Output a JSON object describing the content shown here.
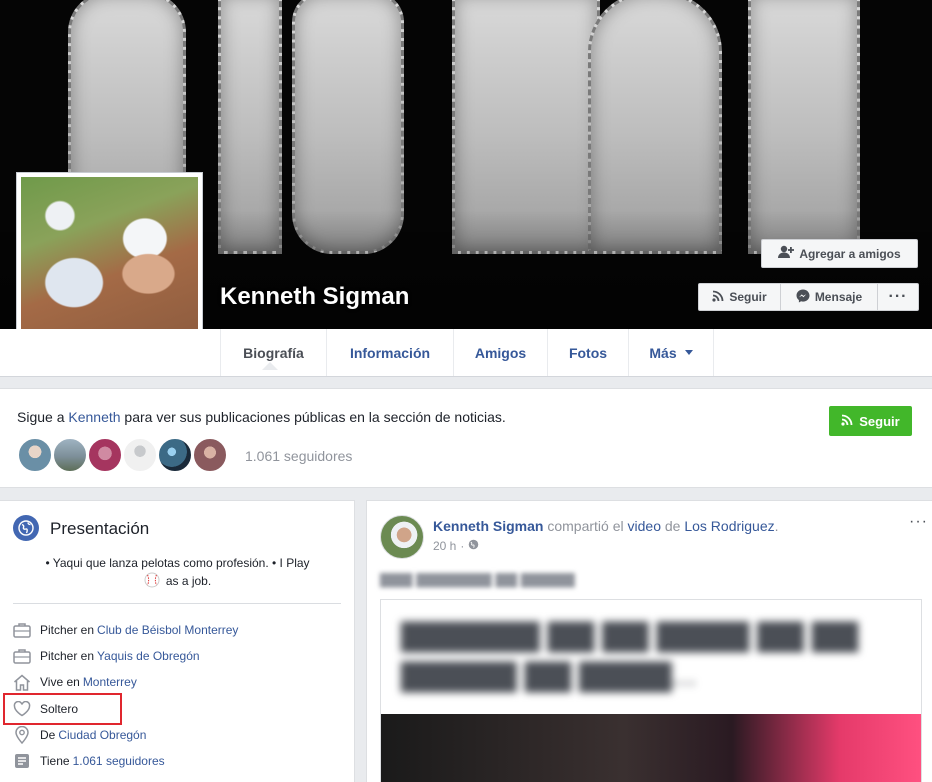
{
  "cover": {
    "text": "SIGMAN"
  },
  "profile": {
    "name": "Kenneth Sigman"
  },
  "actions": {
    "add_friend": "Agregar a amigos",
    "follow": "Seguir",
    "message": "Mensaje",
    "more": "···"
  },
  "nav": {
    "tabs": [
      {
        "label": "Biografía"
      },
      {
        "label": "Información"
      },
      {
        "label": "Amigos"
      },
      {
        "label": "Fotos"
      },
      {
        "label": "Más"
      }
    ]
  },
  "follow_card": {
    "prefix": "Sigue a ",
    "name_link": "Kenneth",
    "suffix": " para ver sus publicaciones públicas en la sección de noticias.",
    "button": "Seguir",
    "followers": "1.061 seguidores",
    "avatar_colors": [
      "#6a8fa6",
      "#7d8f99",
      "#a5355f",
      "#f0f0f0",
      "#3c6a86",
      "#8a5a5e"
    ]
  },
  "intro": {
    "title": "Presentación",
    "bio_line1": "• Yaqui que lanza pelotas como profesión. • I Play",
    "bio_line2": "as a job.",
    "items": [
      {
        "icon": "briefcase-icon",
        "prefix": "Pitcher en ",
        "link": "Club de Béisbol Monterrey"
      },
      {
        "icon": "briefcase-icon",
        "prefix": "Pitcher en ",
        "link": "Yaquis de Obregón"
      },
      {
        "icon": "home-icon",
        "prefix": "Vive en ",
        "link": "Monterrey"
      },
      {
        "icon": "heart-icon",
        "prefix": "Soltero",
        "link": ""
      },
      {
        "icon": "location-pin-icon",
        "prefix": "De ",
        "link": "Ciudad Obregón"
      },
      {
        "icon": "followers-icon",
        "prefix": "Tiene ",
        "link": "1.061 seguidores"
      }
    ]
  },
  "post": {
    "author": "Kenneth Sigman",
    "shared": " compartió el ",
    "video": "video",
    "de": " de ",
    "source": "Los Rodriguez",
    "time": "20 h",
    "more": "···"
  },
  "colors": {
    "link": "#365899",
    "green": "#42b72a",
    "highlight": "#e0262e"
  }
}
